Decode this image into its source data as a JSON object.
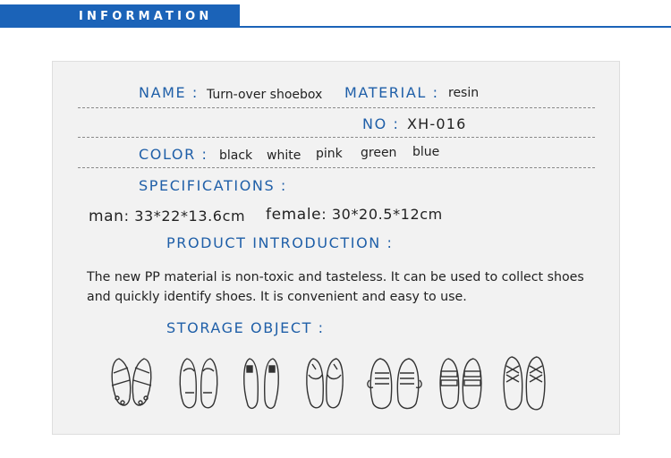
{
  "header": {
    "title": "INFORMATION"
  },
  "info": {
    "name_label": "NAME :",
    "name_value": "Turn-over shoebox",
    "material_label": "MATERIAL :",
    "material_value": "resin",
    "no_label": "NO :",
    "no_value": "XH-016",
    "color_label": "COLOR :",
    "colors": [
      "black",
      "white",
      "pink",
      "green",
      "blue"
    ],
    "specs_label": "SPECIFICATIONS :",
    "man_label": "man",
    "man_value": ": 33*22*13.6cm",
    "female_label": "female",
    "female_value": ": 30*20.5*12cm",
    "intro_label": "PRODUCT INTRODUCTION :",
    "intro_text": "The new PP material is non-toxic and tasteless. It can be used to collect shoes and quickly identify shoes. It is convenient and easy to use.",
    "storage_label": "STORAGE OBJECT :"
  },
  "storage_icons": [
    "sandal-icon",
    "flat-shoe-icon",
    "pump-icon",
    "ballet-flat-icon",
    "sneaker-icon",
    "velcro-sneaker-icon",
    "lace-boot-icon"
  ]
}
